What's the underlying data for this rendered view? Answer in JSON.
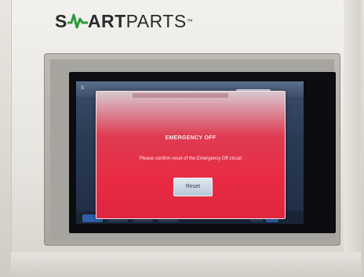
{
  "logo": {
    "bold": "SMART",
    "light": "PARTS",
    "tm": "™",
    "pulse_color": "#2e9b3a"
  },
  "hmi": {
    "top_tab_left": "S",
    "top_tab_right": "",
    "bottom_buttons": [
      "",
      "",
      "",
      ""
    ],
    "corner_text": ""
  },
  "dialog": {
    "header": "",
    "title": "EMERGENCY OFF",
    "message": "Please confirm reset of the Emergency Off circuit",
    "reset_label": "Reset",
    "background_color": "#e82b42"
  }
}
